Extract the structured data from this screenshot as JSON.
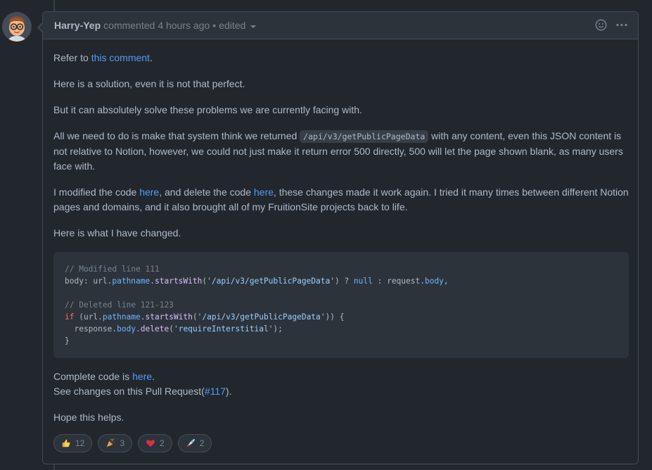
{
  "comment": {
    "author": "Harry-Yep",
    "action": "commented",
    "time": "4 hours ago",
    "separator": "•",
    "edited": "edited"
  },
  "body": {
    "p1_prefix": "Refer to ",
    "p1_link": "this comment",
    "p1_suffix": ".",
    "p2": "Here is a solution, even it is not that perfect.",
    "p3": "But it can absolutely solve these problems we are currently facing with.",
    "p4_prefix": "All we need to do is make that system think we returned ",
    "p4_code": "/api/v3/getPublicPageData",
    "p4_suffix": " with any content, even this JSON content is not relative to Notion, however, we could not just make it return error 500 directly, 500 will let the page shown blank, as many users face with.",
    "p5_a": "I modified the code ",
    "p5_link1": "here",
    "p5_b": ", and delete the code ",
    "p5_link2": "here",
    "p5_c": ", these changes made it work again. I tried it many times between different Notion pages and domains, and it also brought all of my FruitionSite projects back to life.",
    "p6": "Here is what I have changed.",
    "p7_prefix": "Complete code is ",
    "p7_link": "here",
    "p7_suffix": ".",
    "p8_prefix": "See changes on this Pull Request(",
    "p8_link": "#117",
    "p8_suffix": ").",
    "p9": "Hope this helps."
  },
  "code": {
    "l1": "// Modified line 111",
    "l2_a": "body: url.",
    "l2_b": "pathname",
    "l2_c": ".",
    "l2_d": "startsWith",
    "l2_e": "(",
    "l2_f": "'/api/v3/getPublicPageData'",
    "l2_g": ") ? ",
    "l2_h": "null",
    "l2_i": " : request.",
    "l2_j": "body",
    "l2_k": ",",
    "l4": "// Deleted line 121-123",
    "l5_a": "if",
    "l5_b": " (url.",
    "l5_c": "pathname",
    "l5_d": ".",
    "l5_e": "startsWith",
    "l5_f": "(",
    "l5_g": "'/api/v3/getPublicPageData'",
    "l5_h": ")) {",
    "l6_a": "  response.",
    "l6_b": "body",
    "l6_c": ".",
    "l6_d": "delete",
    "l6_e": "(",
    "l6_f": "'requireInterstitial'",
    "l6_g": ");",
    "l7": "}"
  },
  "reactions": [
    {
      "icon": "thumbs-up-icon",
      "count": "12"
    },
    {
      "icon": "party-popper-icon",
      "count": "3"
    },
    {
      "icon": "heart-icon",
      "count": "2"
    },
    {
      "icon": "rocket-icon",
      "count": "2"
    }
  ]
}
